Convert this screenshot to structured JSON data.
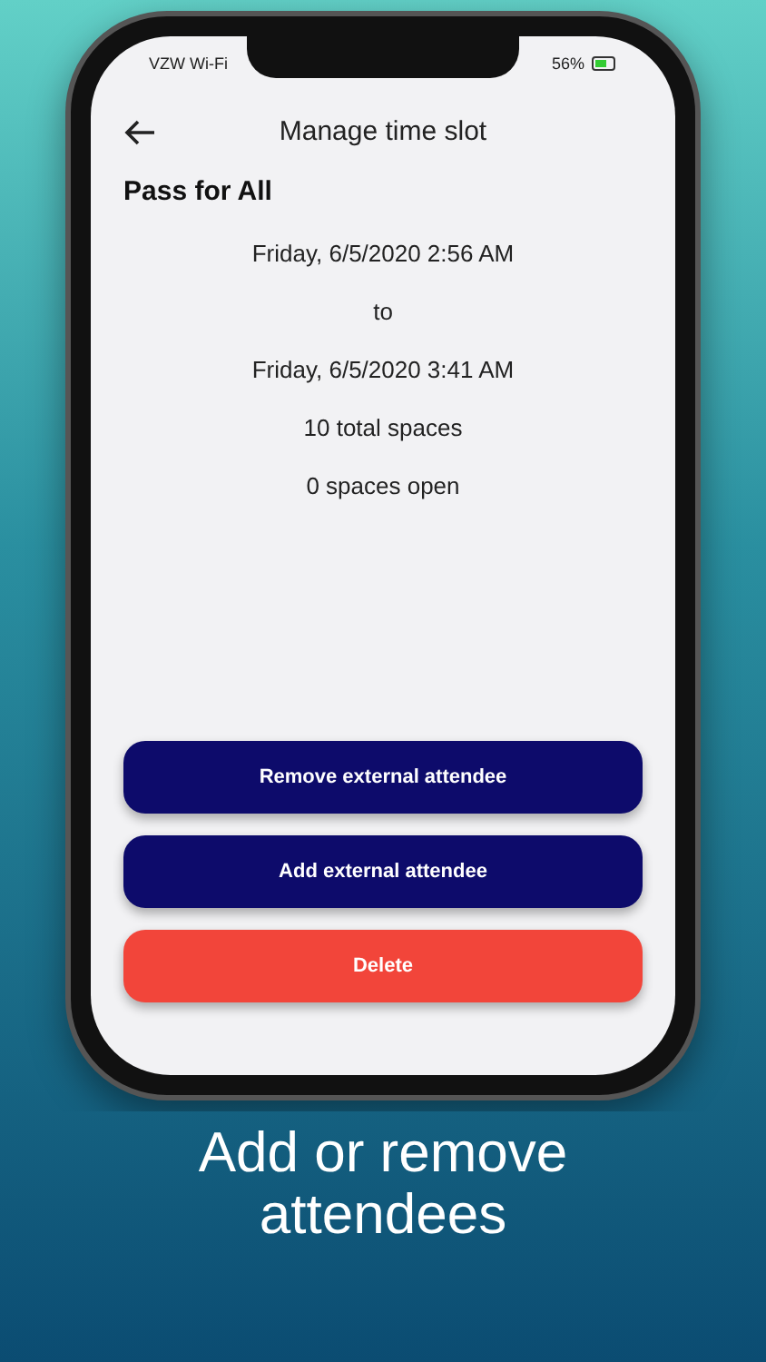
{
  "status_bar": {
    "carrier": "VZW Wi-Fi",
    "battery": "56%"
  },
  "header": {
    "title": "Manage time slot"
  },
  "event": {
    "name": "Pass for All",
    "details": [
      "Friday, 6/5/2020 2:56 AM",
      "to",
      "Friday, 6/5/2020 3:41 AM",
      "10 total spaces",
      "0 spaces open"
    ]
  },
  "buttons": [
    {
      "label": "Remove external attendee",
      "kind": "primary"
    },
    {
      "label": "Add external attendee",
      "kind": "primary"
    },
    {
      "label": "Delete",
      "kind": "danger"
    }
  ],
  "caption": "Add or remove attendees"
}
